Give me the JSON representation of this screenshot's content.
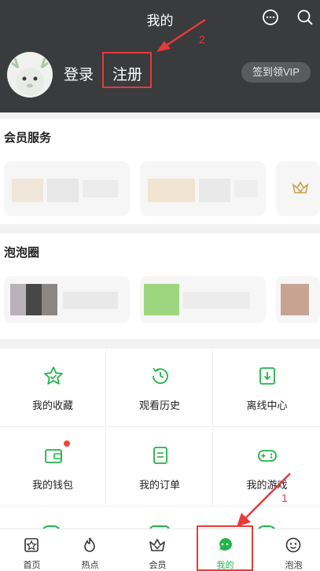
{
  "header": {
    "title": "我的",
    "login_label": "登录",
    "register_label": "注册",
    "vip_label": "签到领VIP",
    "annotation_2": "2"
  },
  "member_services": {
    "title": "会员服务"
  },
  "bubble_circle": {
    "title": "泡泡圈"
  },
  "grid": {
    "items": [
      {
        "label": "我的收藏",
        "icon": "star-icon"
      },
      {
        "label": "观看历史",
        "icon": "history-clock-icon"
      },
      {
        "label": "离线中心",
        "icon": "download-icon"
      },
      {
        "label": "我的钱包",
        "icon": "wallet-icon"
      },
      {
        "label": "我的订单",
        "icon": "order-icon"
      },
      {
        "label": "我的游戏",
        "icon": "gamepad-icon"
      }
    ]
  },
  "tabbar": {
    "items": [
      {
        "label": "首页",
        "icon": "home-icon"
      },
      {
        "label": "热点",
        "icon": "fire-icon"
      },
      {
        "label": "会员",
        "icon": "crown-icon"
      },
      {
        "label": "我的",
        "icon": "bubble-me-icon"
      },
      {
        "label": "泡泡",
        "icon": "bubble-face-icon"
      }
    ],
    "annotation_1": "1"
  },
  "colors": {
    "header_bg": "#3a3b3d",
    "accent_green": "#22b34a",
    "annotation_red": "#e63a3a"
  }
}
